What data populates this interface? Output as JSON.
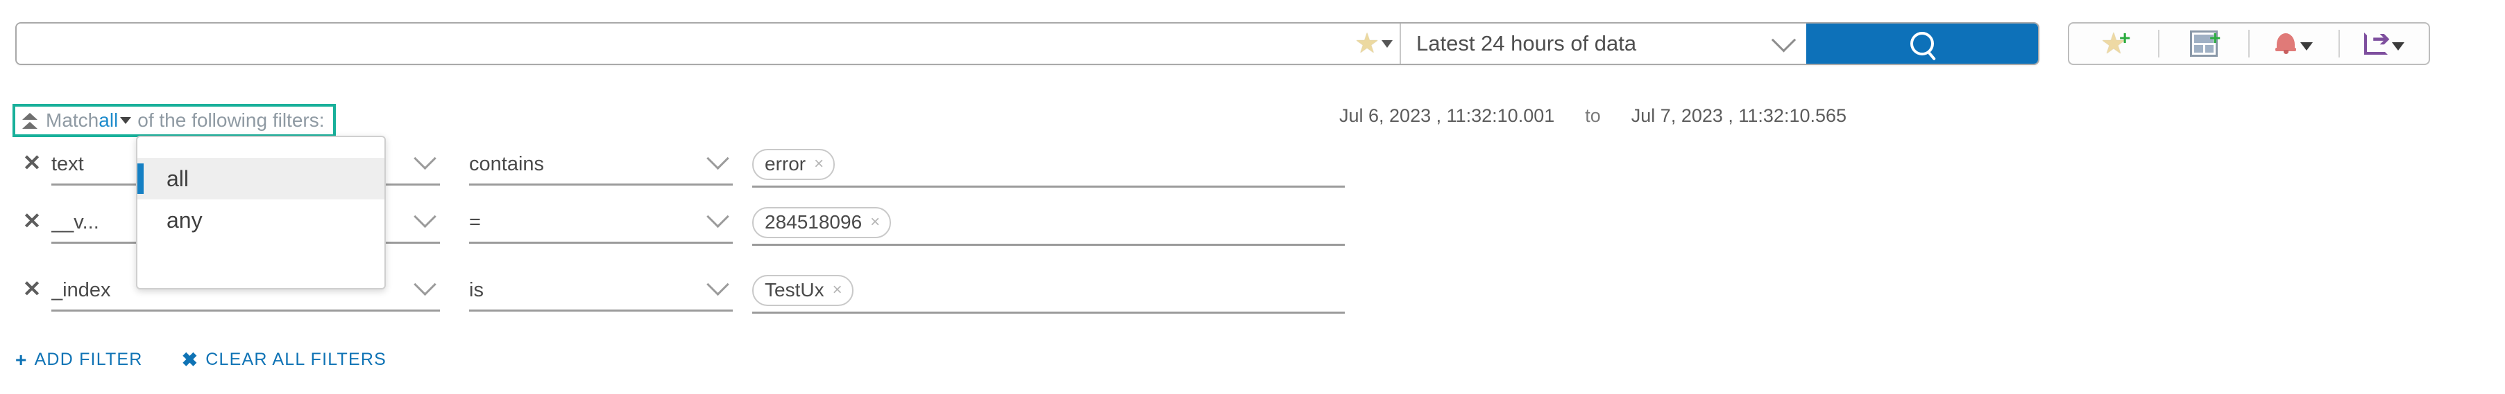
{
  "search": {
    "query_value": "",
    "placeholder": "",
    "star_icon": "star-dropdown-icon",
    "time_range_label": "Latest 24 hours of data",
    "search_icon": "search-icon"
  },
  "toolbar": {
    "items": [
      {
        "icon": "add-to-favorites-icon",
        "label": ""
      },
      {
        "icon": "add-to-dashboard-icon",
        "label": ""
      },
      {
        "icon": "alert-bell-icon",
        "label": ""
      },
      {
        "icon": "share-export-icon",
        "label": ""
      }
    ]
  },
  "filter_bar": {
    "collapse_icon": "collapse-toggle-icon",
    "match_prefix": "Match",
    "match_value": "all",
    "match_suffix": "of the following filters:",
    "dropdown": {
      "open": true,
      "options": [
        {
          "label": "all",
          "selected": true
        },
        {
          "label": "any",
          "selected": false
        }
      ]
    }
  },
  "time_range": {
    "from": "Jul 6, 2023 ,  11:32:10.001",
    "to_label": "to",
    "to": "Jul 7, 2023 ,  11:32:10.565"
  },
  "filters": [
    {
      "remove_label": "✕",
      "field": "text",
      "operator": "contains",
      "values": [
        {
          "text": "error",
          "remove": "×"
        }
      ]
    },
    {
      "remove_label": "✕",
      "field": "__v...",
      "operator": "=",
      "values": [
        {
          "text": "284518096",
          "remove": "×"
        }
      ]
    },
    {
      "remove_label": "✕",
      "field": "_index",
      "operator": "is",
      "values": [
        {
          "text": "TestUx",
          "remove": "×"
        }
      ]
    }
  ],
  "actions": {
    "add_filter_symbol": "+",
    "add_filter_label": "ADD FILTER",
    "clear_all_symbol": "✖",
    "clear_all_label": "CLEAR ALL FILTERS"
  },
  "colors": {
    "accent_blue": "#0d71b9",
    "link_blue": "#1f8ccc",
    "focus_teal": "#18b09a",
    "star_yellow": "#eed9a4",
    "bell_red": "#e07a78",
    "share_purple": "#7e4f9e",
    "plus_green": "#2bac3f"
  }
}
